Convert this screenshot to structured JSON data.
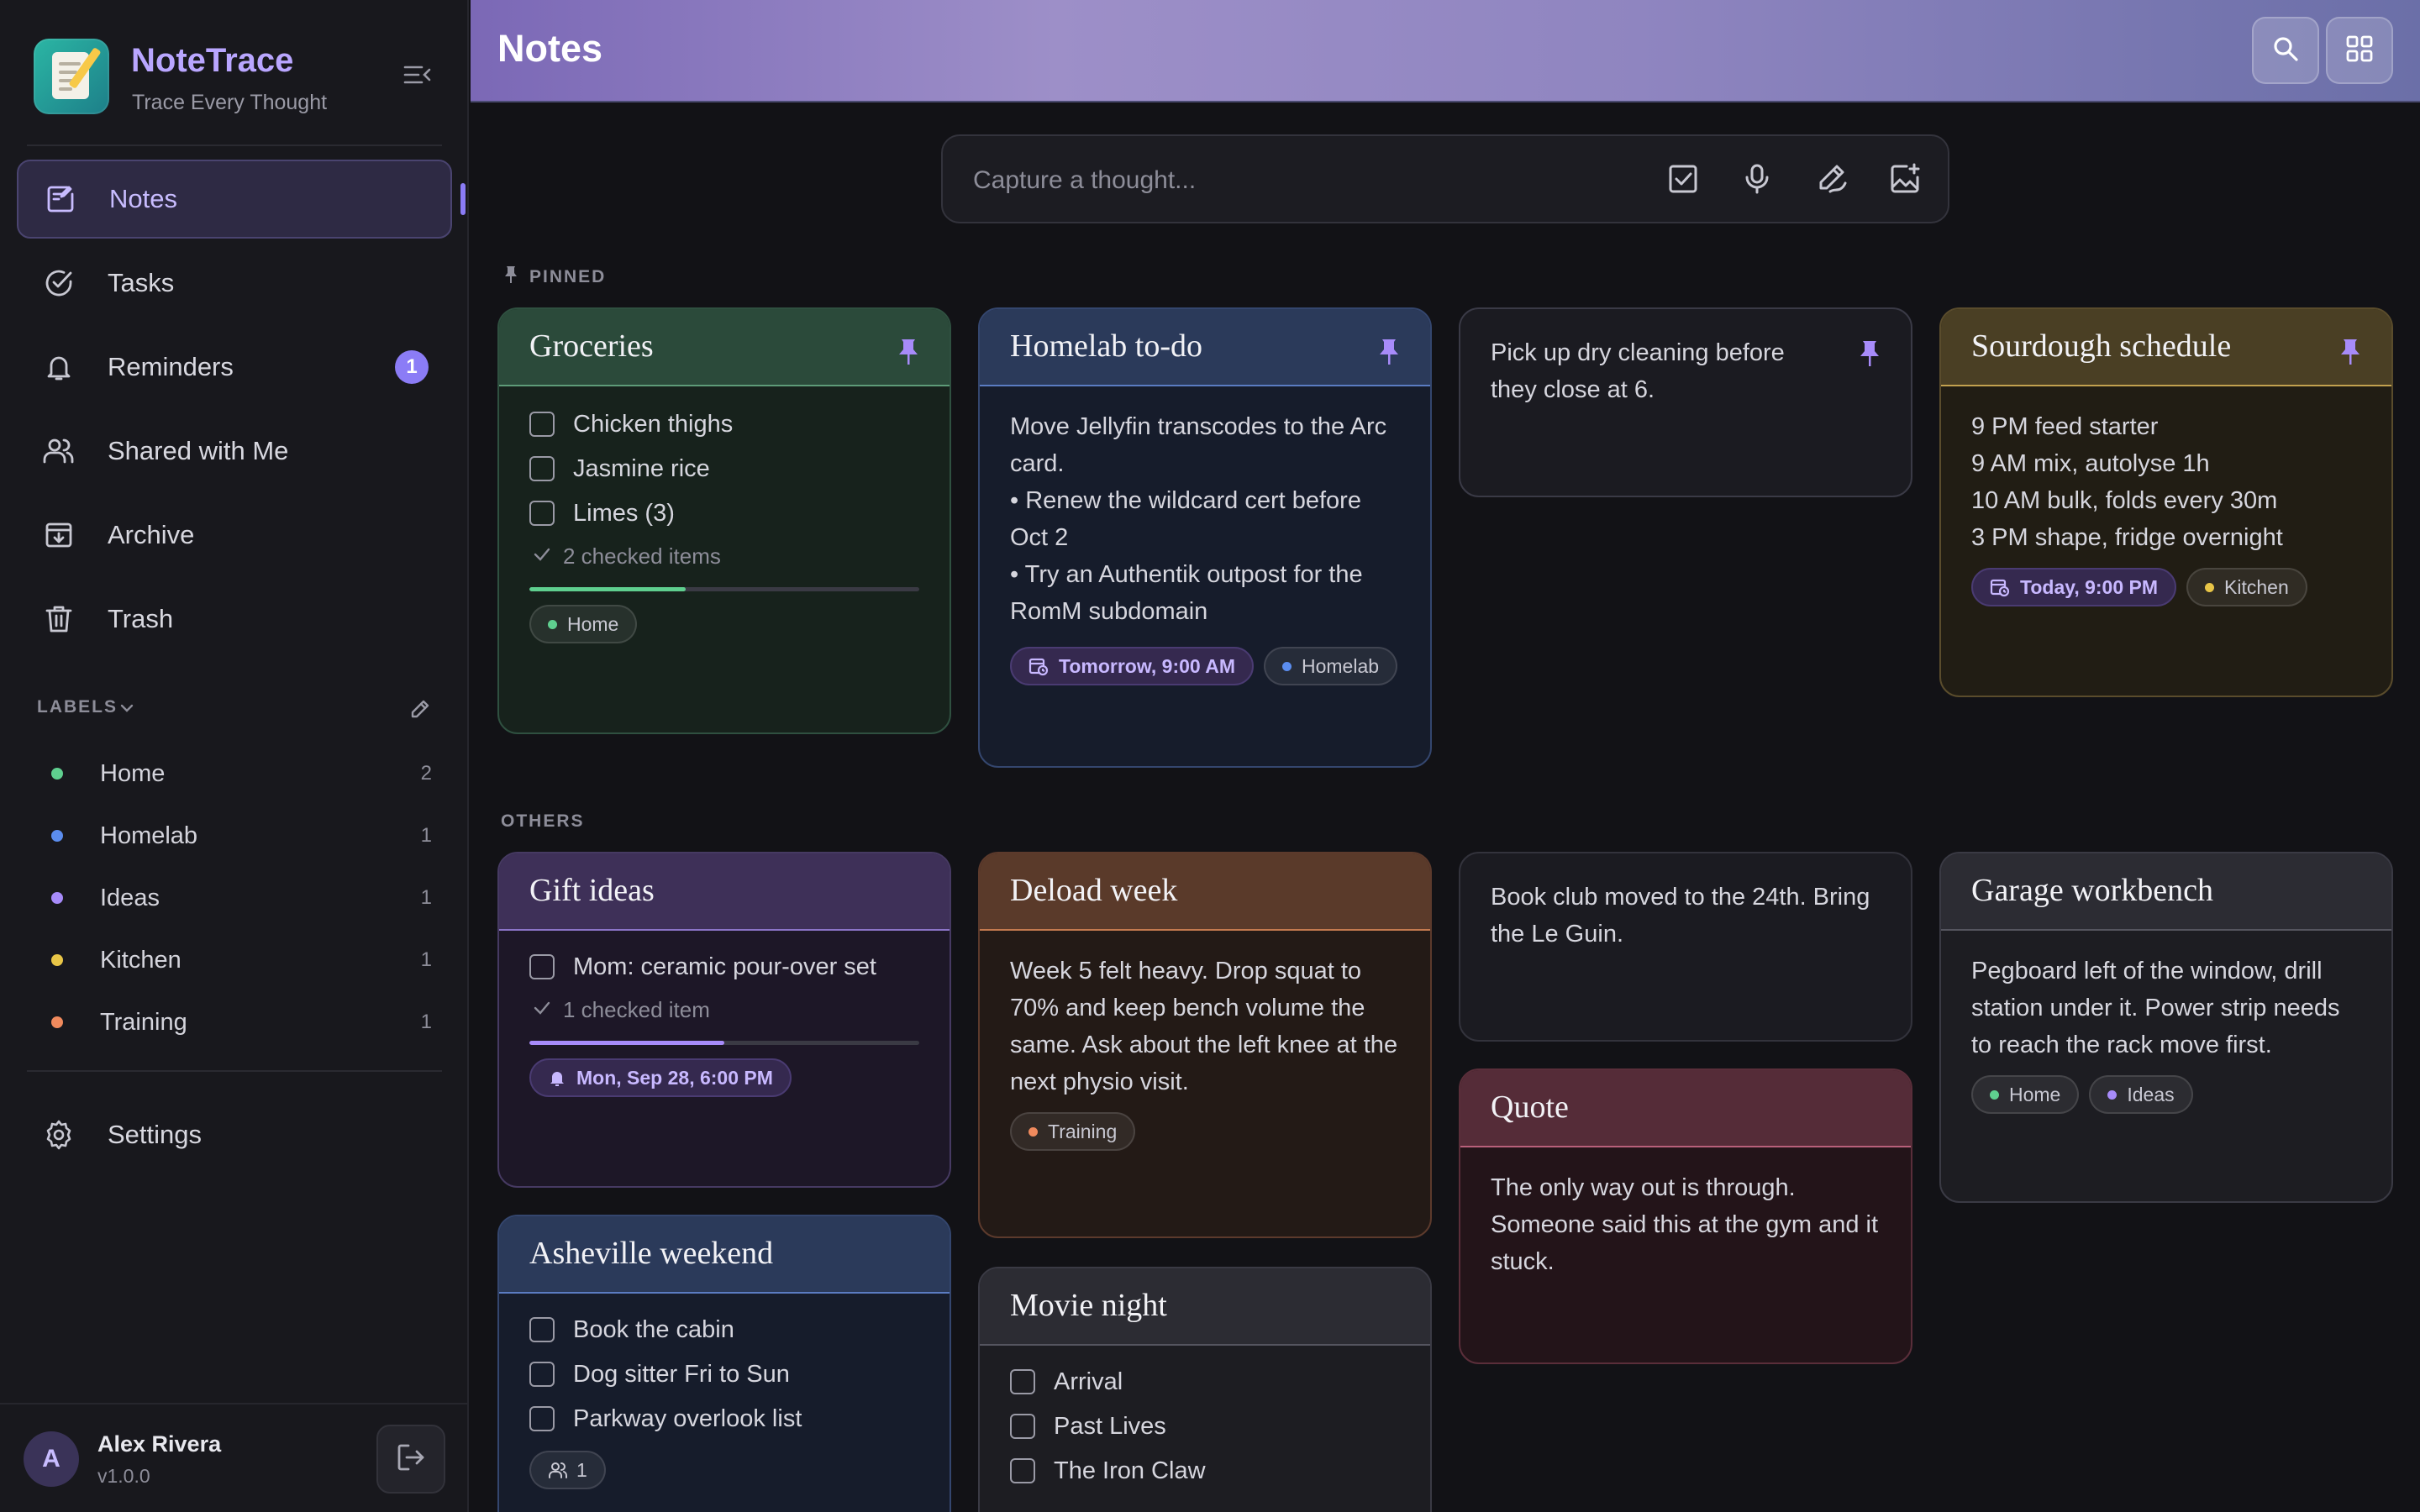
{
  "app": {
    "name": "NoteTrace",
    "tagline": "Trace Every Thought"
  },
  "nav": {
    "items": [
      {
        "label": "Notes",
        "icon": "notes-icon"
      },
      {
        "label": "Tasks",
        "icon": "tasks-icon"
      },
      {
        "label": "Reminders",
        "icon": "bell-icon",
        "badge": "1"
      },
      {
        "label": "Shared with Me",
        "icon": "people-icon"
      },
      {
        "label": "Archive",
        "icon": "archive-icon"
      },
      {
        "label": "Trash",
        "icon": "trash-icon"
      }
    ],
    "settings_label": "Settings"
  },
  "labels": {
    "heading": "LABELS",
    "items": [
      {
        "name": "Home",
        "count": "2",
        "color": "#5fcf8f"
      },
      {
        "name": "Homelab",
        "count": "1",
        "color": "#5b8def"
      },
      {
        "name": "Ideas",
        "count": "1",
        "color": "#a78bfa"
      },
      {
        "name": "Kitchen",
        "count": "1",
        "color": "#e8c547"
      },
      {
        "name": "Training",
        "count": "1",
        "color": "#f08a5d"
      }
    ]
  },
  "user": {
    "initial": "A",
    "name": "Alex Rivera",
    "version": "v1.0.0"
  },
  "header": {
    "title": "Notes"
  },
  "capture": {
    "placeholder": "Capture a thought..."
  },
  "sections": {
    "pinned": "PINNED",
    "others": "OTHERS"
  },
  "colors": {
    "accent": "#8b7cf6",
    "home": "#5fcf8f",
    "homelab": "#5b8def",
    "ideas": "#a78bfa",
    "kitchen": "#e8c547",
    "training": "#f08a5d"
  },
  "notes": {
    "groceries": {
      "title": "Groceries",
      "items": [
        "Chicken thighs",
        "Jasmine rice",
        "Limes (3)"
      ],
      "checked": "2 checked items",
      "progress": 0.4,
      "label": "Home"
    },
    "homelab": {
      "title": "Homelab to-do",
      "lines": [
        "Move Jellyfin transcodes to the Arc card.",
        "• Renew the wildcard cert before Oct 2",
        "• Try an Authentik outpost for the RomM subdomain"
      ],
      "reminder": "Tomorrow, 9:00 AM",
      "label": "Homelab"
    },
    "drycleaning": {
      "text": "Pick up dry cleaning before they close at 6."
    },
    "sourdough": {
      "title": "Sourdough schedule",
      "lines": [
        "9 PM feed starter",
        "9 AM mix, autolyse 1h",
        "10 AM bulk, folds every 30m",
        "3 PM shape, fridge overnight"
      ],
      "reminder": "Today, 9:00 PM",
      "label": "Kitchen"
    },
    "gift": {
      "title": "Gift ideas",
      "items": [
        "Mom: ceramic pour-over set"
      ],
      "checked": "1 checked item",
      "progress": 0.5,
      "reminder": "Mon, Sep 28, 6:00 PM"
    },
    "deload": {
      "title": "Deload week",
      "text": "Week 5 felt heavy. Drop squat to 70% and keep bench volume the same. Ask about the left knee at the next physio visit.",
      "label": "Training"
    },
    "bookclub": {
      "text": "Book club moved to the 24th. Bring the Le Guin."
    },
    "garage": {
      "title": "Garage workbench",
      "text": "Pegboard left of the window, drill station under it. Power strip needs to reach the rack move first.",
      "labels": [
        "Home",
        "Ideas"
      ]
    },
    "quote": {
      "title": "Quote",
      "text": "The only way out is through. Someone said this at the gym and it stuck."
    },
    "asheville": {
      "title": "Asheville weekend",
      "items": [
        "Book the cabin",
        "Dog sitter Fri to Sun",
        "Parkway overlook list"
      ],
      "shared_count": "1"
    },
    "movie": {
      "title": "Movie night",
      "items": [
        "Arrival",
        "Past Lives",
        "The Iron Claw"
      ]
    }
  }
}
